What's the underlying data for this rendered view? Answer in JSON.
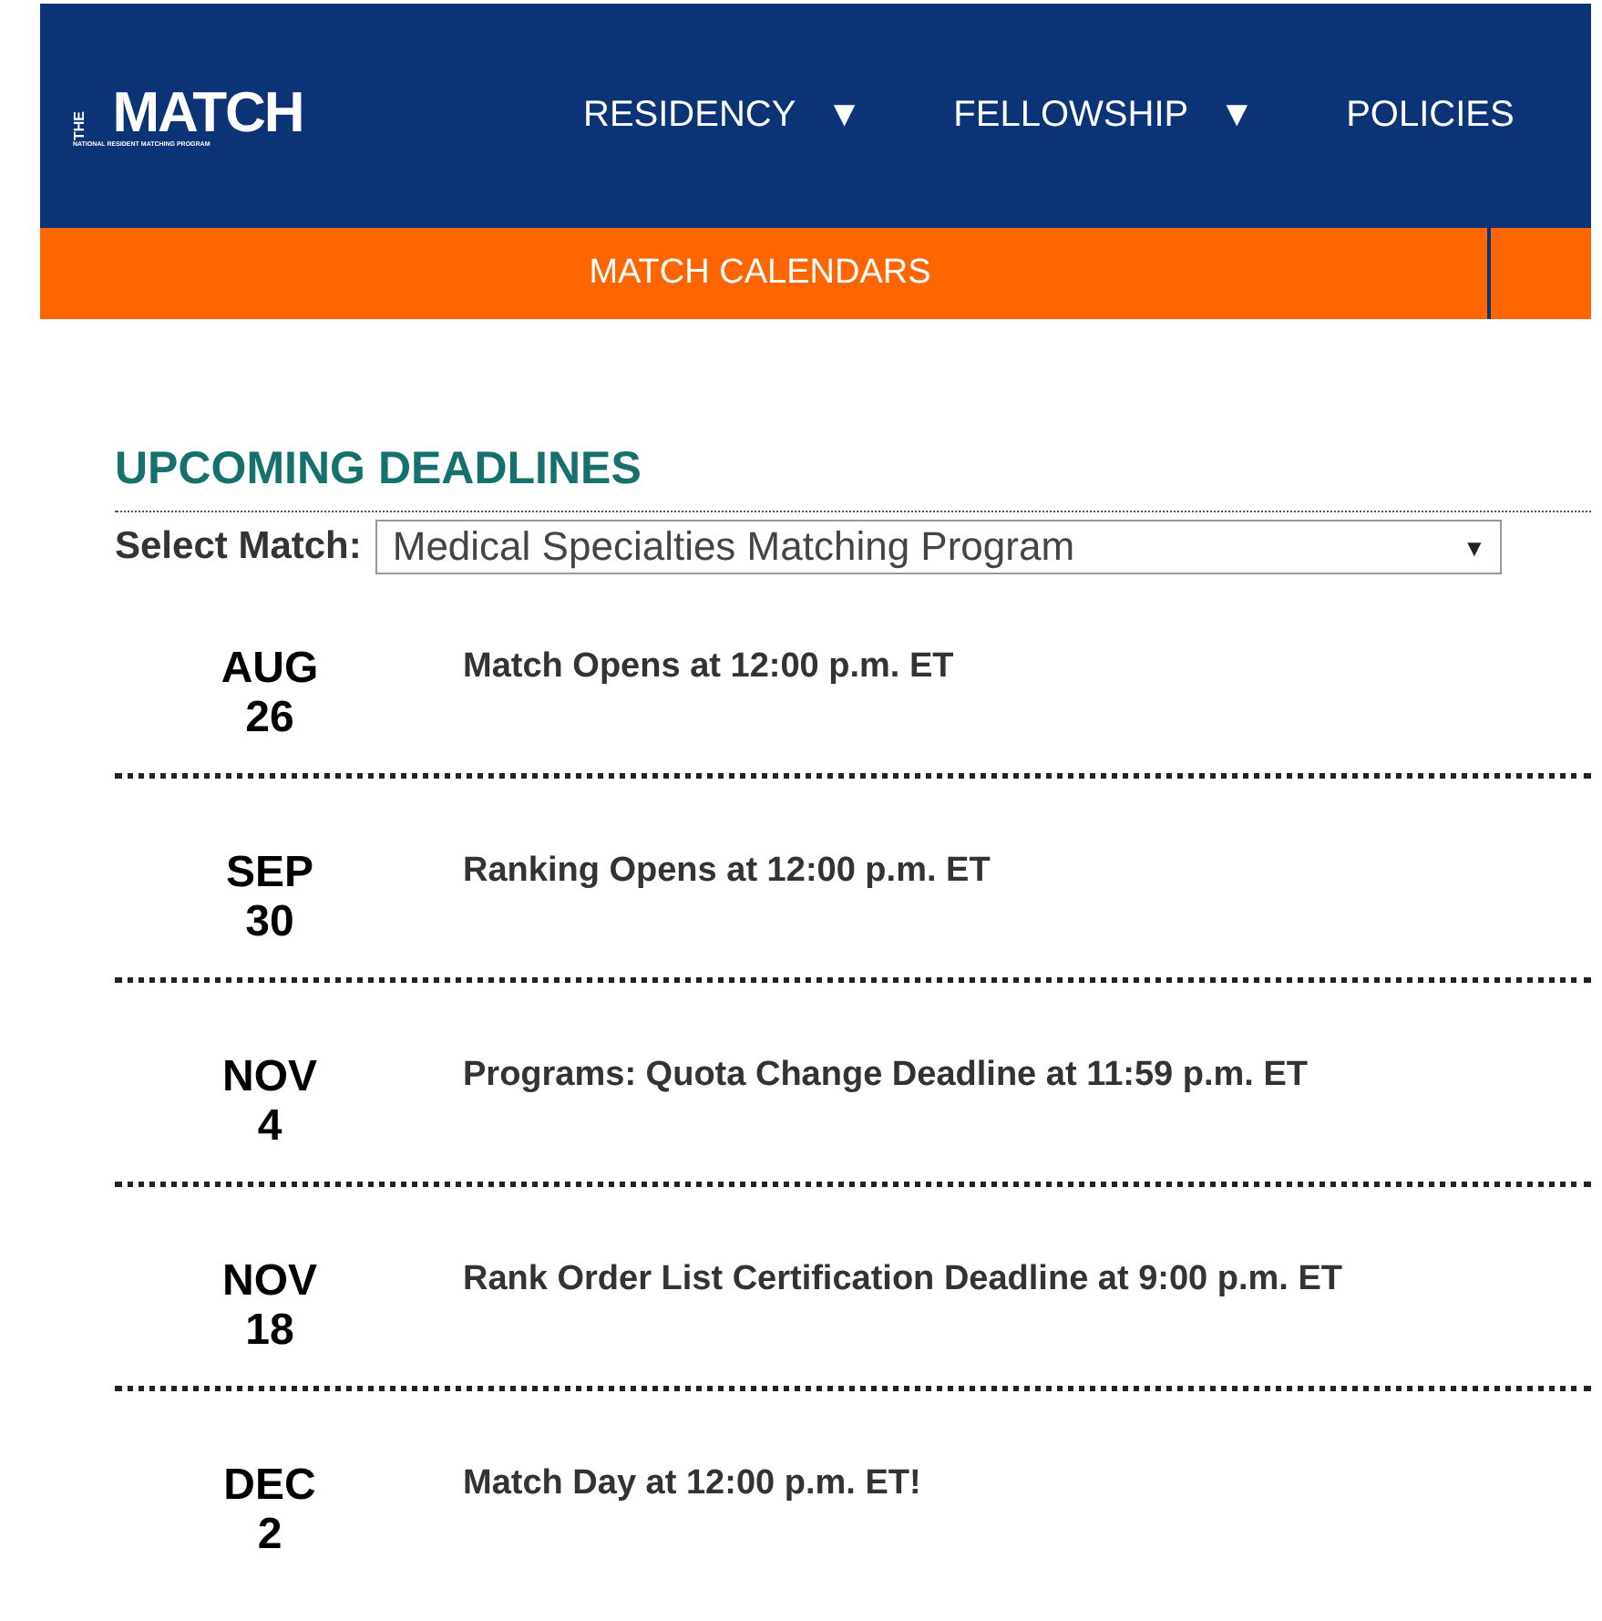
{
  "logo": {
    "small": "THE",
    "main": "MATCH",
    "tagline": "NATIONAL RESIDENT MATCHING PROGRAM"
  },
  "nav": [
    {
      "label": "RESIDENCY",
      "caret": "▼"
    },
    {
      "label": "FELLOWSHIP",
      "caret": "▼"
    },
    {
      "label": "POLICIES"
    }
  ],
  "subnav": {
    "label": "MATCH CALENDARS"
  },
  "section_title": "UPCOMING DEADLINES",
  "select": {
    "label": "Select Match:",
    "value": "Medical Specialties Matching Program",
    "caret": "▼"
  },
  "deadlines": [
    {
      "month": "AUG",
      "day": "26",
      "text": "Match Opens at 12:00 p.m. ET"
    },
    {
      "month": "SEP",
      "day": "30",
      "text": "Ranking Opens at 12:00 p.m. ET"
    },
    {
      "month": "NOV",
      "day": "4",
      "text": "Programs: Quota Change Deadline at 11:59 p.m. ET"
    },
    {
      "month": "NOV",
      "day": "18",
      "text": "Rank Order List Certification Deadline at 9:00 p.m. ET"
    },
    {
      "month": "DEC",
      "day": "2",
      "text": "Match Day at 12:00 p.m. ET!"
    }
  ]
}
